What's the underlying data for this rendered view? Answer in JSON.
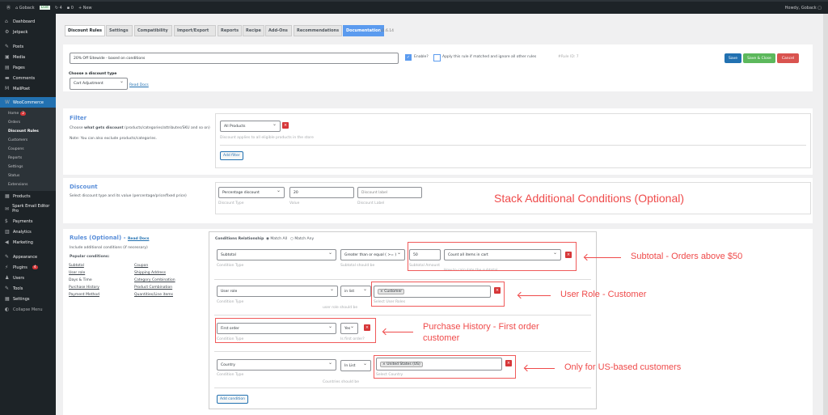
{
  "adminbar": {
    "site": "Goback",
    "live": "Live",
    "updates": "4",
    "comments": "0",
    "new": "New",
    "howdy": "Howdy, Goback"
  },
  "sidebar": {
    "top": [
      {
        "label": "Dashboard",
        "icon": "dashboard-icon"
      },
      {
        "label": "Jetpack",
        "icon": "jetpack-icon"
      },
      {
        "label": "Posts",
        "icon": "pin-icon"
      },
      {
        "label": "Media",
        "icon": "media-icon"
      },
      {
        "label": "Pages",
        "icon": "pages-icon"
      },
      {
        "label": "Comments",
        "icon": "comment-icon"
      },
      {
        "label": "MailPoet",
        "icon": "mailpoet-icon"
      }
    ],
    "woo": "WooCommerce",
    "woo_sub": [
      {
        "label": "Home",
        "badge": "2"
      },
      {
        "label": "Orders"
      },
      {
        "label": "Discount Rules",
        "current": true
      },
      {
        "label": "Customers"
      },
      {
        "label": "Coupons"
      },
      {
        "label": "Reports"
      },
      {
        "label": "Settings"
      },
      {
        "label": "Status"
      },
      {
        "label": "Extensions"
      }
    ],
    "bottom": [
      {
        "label": "Products"
      },
      {
        "label": "Spark Email Editor Pro"
      },
      {
        "label": "Payments"
      },
      {
        "label": "Analytics"
      },
      {
        "label": "Marketing"
      },
      {
        "label": "Appearance"
      },
      {
        "label": "Plugins",
        "badge": "4"
      },
      {
        "label": "Users"
      },
      {
        "label": "Tools"
      },
      {
        "label": "Settings"
      },
      {
        "label": "Collapse Menu"
      }
    ]
  },
  "tabs": [
    "Discount Rules",
    "Settings",
    "Compatibility",
    "Import/Export",
    "Reports",
    "Recipe",
    "Add-Ons",
    "Recommendations",
    "Documentation"
  ],
  "version": "v2.6.14",
  "header": {
    "rule_title": "20% Off Sitewide - based on conditions",
    "enable": "Enable?",
    "apply_rule": "Apply this rule if matched and ignore all other rules",
    "rule_id": "#Rule ID: 7",
    "discount_type_label": "Choose a discount type",
    "discount_type": "Cart Adjustment",
    "read_docs": "Read Docs",
    "save": "Save",
    "save_close": "Save & Close",
    "cancel": "Cancel"
  },
  "filter": {
    "title": "Filter",
    "desc_pre": "Choose ",
    "desc_bold": "what gets discount",
    "desc_post": " (products/categories/attributes/SKU and so on)",
    "note": "Note: You can also exclude products/categories.",
    "value": "All Products",
    "hint": "Discount applies to all eligible products in the store",
    "add": "Add filter"
  },
  "discount": {
    "title": "Discount",
    "desc": "Select discount type and its value (percentage/price/fixed price)",
    "type": "Percentage discount",
    "type_label": "Discount Type",
    "value": "20",
    "value_label": "Value",
    "label_placeholder": "Discount label",
    "label_label": "Discount Label"
  },
  "rules": {
    "title": "Rules (Optional) -",
    "read_docs": "Read Docs",
    "desc": "Include additional conditions (if necessary)",
    "popular": "Popular conditions:",
    "col1": [
      "Subtotal",
      "User role",
      "Days & Time",
      "Purchase History",
      "Payment Method"
    ],
    "col2": [
      "Coupon",
      "Shipping Address",
      "Category Combination",
      "Product Combination",
      "Quantities/Line items"
    ],
    "relationship": "Conditions Relationship",
    "match_all": "Match All",
    "match_any": "Match Any",
    "c1": {
      "type": "Subtotal",
      "type_label": "Condition Type",
      "op": "Greater than or equal ( >= )",
      "op_label": "Subtotal should be",
      "amount": "50",
      "amount_label": "Subtotal Amount",
      "calc": "Count all items in cart",
      "calc_label": "How to calculate the subtotal"
    },
    "c2": {
      "type": "User role",
      "type_label": "Condition Type",
      "op": "in list",
      "op_label": "user role should be",
      "tag": "× Customer",
      "tag_label": "Select User Roles"
    },
    "c3": {
      "type": "First order",
      "type_label": "Condition Type",
      "op": "Yes",
      "op_label": "Is first order?"
    },
    "c4": {
      "type": "Country",
      "type_label": "Condition Type",
      "op": "In List",
      "op_label": "Countries should be",
      "tag": "× United States (US)",
      "tag_label": "Select Country"
    },
    "add": "Add condition"
  },
  "annotations": {
    "stack": "Stack Additional Conditions (Optional)",
    "subtotal": "Subtotal - Orders above $50",
    "role": "User Role - Customer",
    "history1": "Purchase History - First order",
    "history2": "customer",
    "country": "Only for US-based customers"
  },
  "colors": {
    "annotation": "#ef4b4b",
    "primary": "#2271b1",
    "save_close": "#5cb85c",
    "cancel": "#d9534f",
    "documentation": "#5b9bef"
  }
}
